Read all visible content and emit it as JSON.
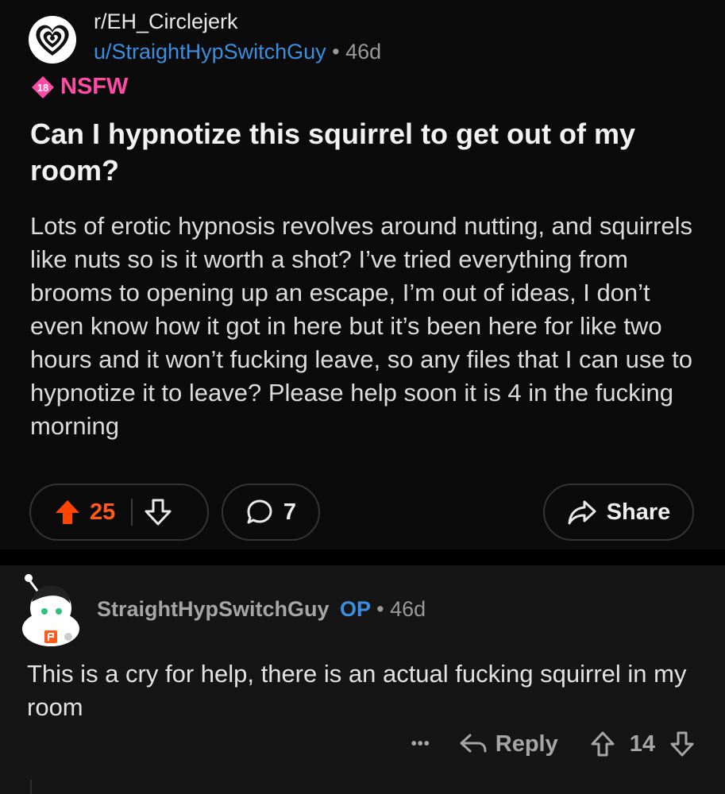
{
  "post": {
    "subreddit": "r/EH_Circlejerk",
    "author": "u/StraightHypSwitchGuy",
    "separator": "•",
    "age": "46d",
    "nsfw_badge_number": "18",
    "nsfw_label": "NSFW",
    "title": "Can I hypnotize this squirrel to get out of my room?",
    "body": "Lots of erotic hypnosis revolves around nutting, and squirrels like nuts so is it worth a shot? I’ve tried everything from brooms to opening up an escape, I’m out of ideas, I don’t even know how it got in here but it’s been here for like two hours and it won’t fucking leave, so any files that I can use to hypnotize it to leave? Please help soon it is 4 in the fucking morning",
    "votes": "25",
    "comments": "7",
    "share_label": "Share"
  },
  "comment": {
    "author": "StraightHypSwitchGuy",
    "op_tag": "OP",
    "separator": "•",
    "age": "46d",
    "body": "This is a cry for help, there is an actual fucking squirrel in my room",
    "more": "•••",
    "reply_label": "Reply",
    "votes": "14"
  },
  "colors": {
    "upvote": "#ff4500",
    "link": "#3b8fe0",
    "nsfw": "#ff4aa6"
  }
}
